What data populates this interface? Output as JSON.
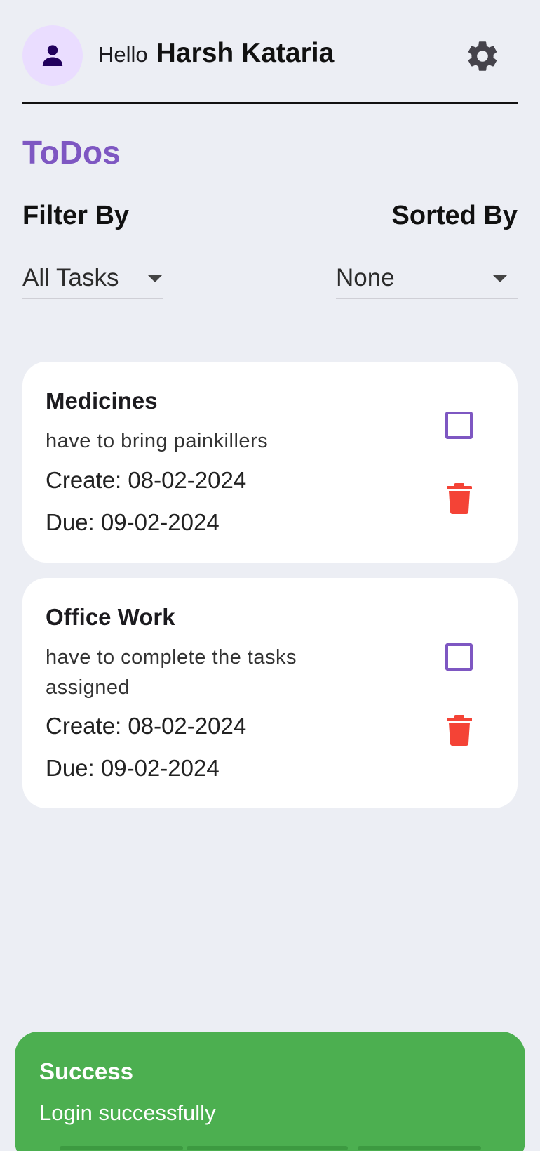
{
  "header": {
    "avatar_icon": "person-icon",
    "greeting": "Hello",
    "user_name": "Harsh Kataria",
    "settings_icon": "gear-icon"
  },
  "page_title": "ToDos",
  "filter": {
    "label": "Filter By",
    "selected": "All Tasks"
  },
  "sort": {
    "label": "Sorted By",
    "selected": "None"
  },
  "tasks": [
    {
      "title": "Medicines",
      "description": "have to bring painkillers",
      "created": "Create: 08-02-2024",
      "due": "Due: 09-02-2024",
      "completed": false
    },
    {
      "title": "Office Work",
      "description": "have to complete the tasks assigned",
      "created": "Create: 08-02-2024",
      "due": "Due: 09-02-2024",
      "completed": false
    }
  ],
  "toast": {
    "title": "Success",
    "message": "Login successfully"
  },
  "colors": {
    "accent": "#7e57c2",
    "background": "#eceef4",
    "delete": "#f44336",
    "success": "#4caf50",
    "avatar_bg": "#eaddff"
  }
}
